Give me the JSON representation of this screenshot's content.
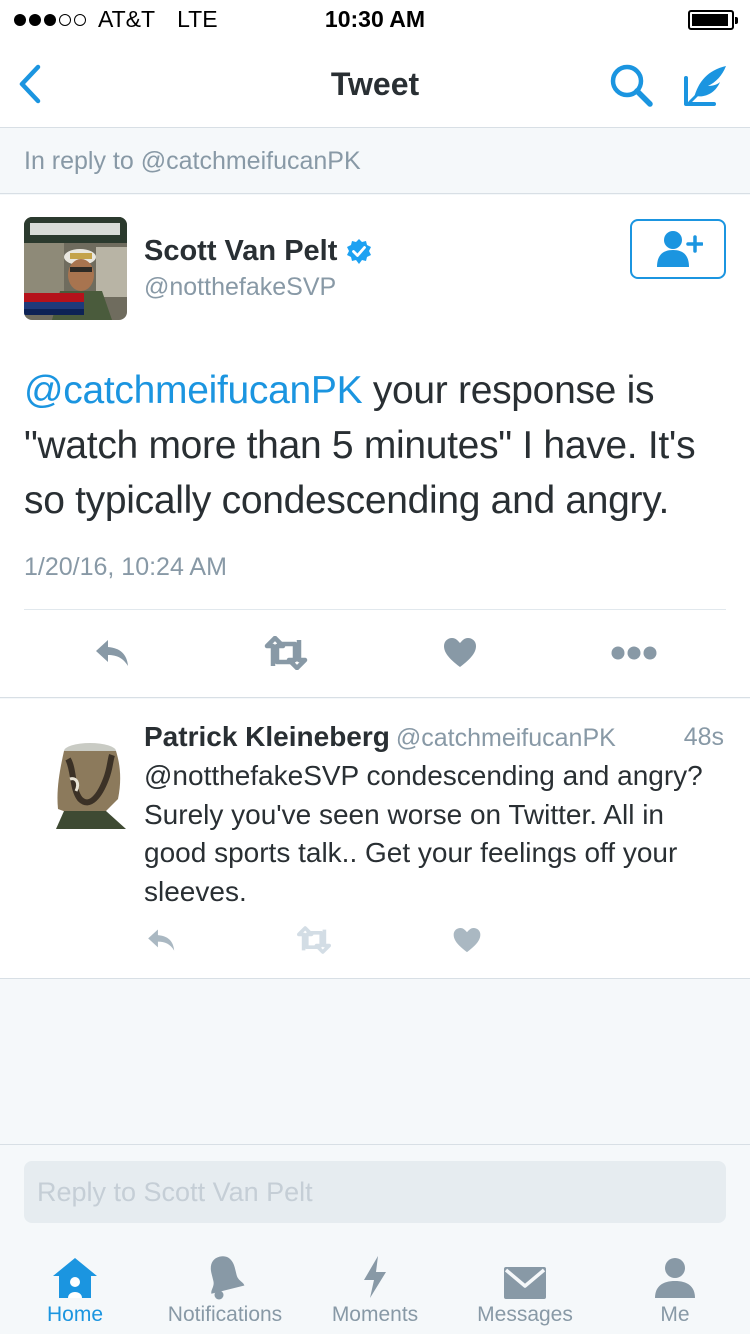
{
  "status_bar": {
    "carrier": "AT&T",
    "network": "LTE",
    "time": "10:30 AM",
    "signal_filled": 3,
    "signal_total": 5
  },
  "nav": {
    "title": "Tweet",
    "back_icon": "chevron-left-icon",
    "search_icon": "search-icon",
    "compose_icon": "compose-icon"
  },
  "in_reply_to": "In reply to @catchmeifucanPK",
  "tweet": {
    "author_name": "Scott Van Pelt",
    "author_handle": "@notthefakeSVP",
    "verified": true,
    "mention": "@catchmeifucanPK",
    "body": " your response is \"watch more than 5 minutes\"  I have. It's so typically condescending and angry.",
    "date": "1/20/16, 10:24 AM"
  },
  "reply": {
    "name": "Patrick Kleineberg",
    "handle": "@catchmeifucanPK",
    "time": "48s",
    "text": "@notthefakeSVP condescending and angry? Surely you've seen worse on Twitter. All in good sports talk.. Get your feelings off your sleeves."
  },
  "compose": {
    "placeholder": "Reply to Scott Van Pelt"
  },
  "tabs": [
    {
      "label": "Home",
      "icon": "home-icon",
      "active": true
    },
    {
      "label": "Notifications",
      "icon": "bell-icon",
      "active": false
    },
    {
      "label": "Moments",
      "icon": "lightning-icon",
      "active": false
    },
    {
      "label": "Messages",
      "icon": "envelope-icon",
      "active": false
    },
    {
      "label": "Me",
      "icon": "person-icon",
      "active": false
    }
  ],
  "colors": {
    "accent": "#1b95e0",
    "text": "#292f33",
    "secondary": "#8899a6",
    "background": "#f5f8fa",
    "action_icon": "#8899a6",
    "reply_action_icon": "#aab8c2"
  }
}
